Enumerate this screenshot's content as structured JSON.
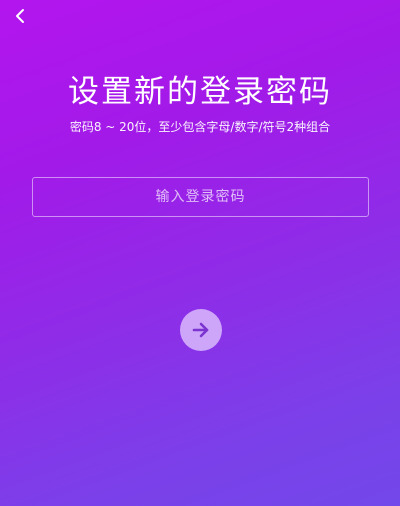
{
  "header": {
    "back_icon": "chevron-left-icon"
  },
  "main": {
    "title": "设置新的登录密码",
    "subtitle": "密码8 ~ 20位，至少包含字母/数字/符号2种组合",
    "password_field": {
      "value": "",
      "placeholder": "输入登录密码"
    },
    "next_button": {
      "icon": "arrow-right-icon"
    }
  },
  "colors": {
    "gradient_top": "#b315ee",
    "gradient_bottom": "#7248ea",
    "next_arrow": "#7b34cf"
  }
}
